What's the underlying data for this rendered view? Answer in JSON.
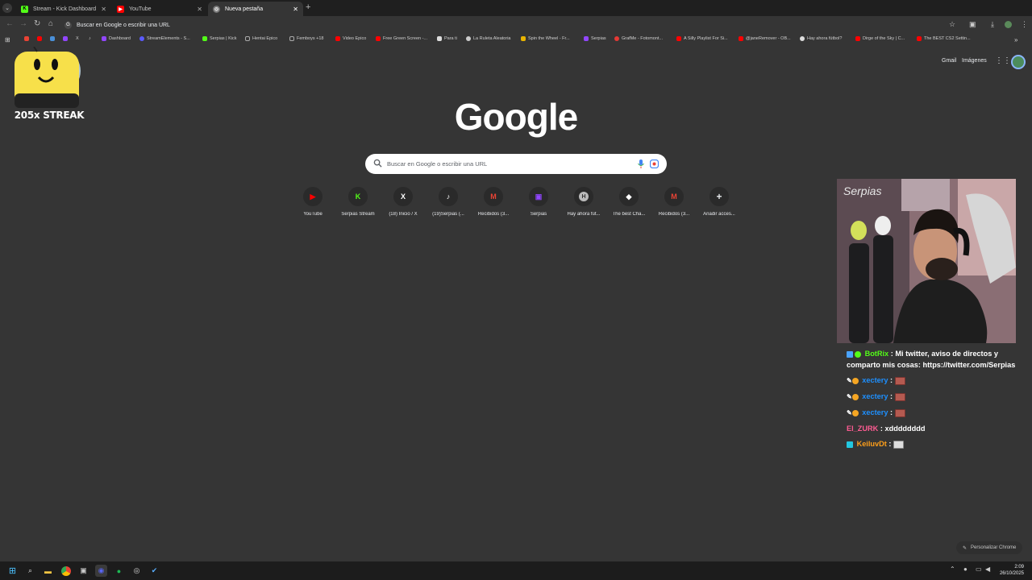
{
  "tabs": [
    {
      "title": "Stream - Kick Dashboard",
      "favicon": "K",
      "color": "#53fc18"
    },
    {
      "title": "YouTube",
      "favicon": "▶",
      "color": "#ff0000"
    },
    {
      "title": "Nueva pestaña",
      "favicon": "◎",
      "color": "#888888"
    }
  ],
  "omnibox": {
    "placeholder": "Buscar en Google o escribir una URL"
  },
  "bookmarks": [
    {
      "label": "Dashboard",
      "color": "#9146ff"
    },
    {
      "label": "StreamElements - S...",
      "color": "#5b5bff"
    },
    {
      "label": "Serpias | Kick",
      "color": "#53fc18"
    },
    {
      "label": "Hentai Epico",
      "color": "#aaaaaa"
    },
    {
      "label": "Femboys +18",
      "color": "#aaaaaa"
    },
    {
      "label": "Video Epico",
      "color": "#ff0000"
    },
    {
      "label": "Free Green Screen -...",
      "color": "#ff0000"
    },
    {
      "label": "Para ti",
      "color": "#dddddd"
    },
    {
      "label": "La Ruleta Aleatoria",
      "color": "#cccccc"
    },
    {
      "label": "Spin the Wheel - Fr...",
      "color": "#e8b400"
    },
    {
      "label": "Serpias",
      "color": "#9146ff"
    },
    {
      "label": "GrafMe - Fotomont...",
      "color": "#e53935"
    },
    {
      "label": "A Silly Playlist For Si...",
      "color": "#ff0000"
    },
    {
      "label": "@janeRemover - OB...",
      "color": "#ff0000"
    },
    {
      "label": "Hay ahora fútbol?",
      "color": "#dddddd"
    },
    {
      "label": "Dirge of the Sky | C...",
      "color": "#ff0000"
    },
    {
      "label": "The BEST CS2 Settin...",
      "color": "#ff0000"
    }
  ],
  "streak": {
    "label": "205x STREAK"
  },
  "header_links": {
    "gmail": "Gmail",
    "images": "Imágenes"
  },
  "logo": "Google",
  "search": {
    "placeholder": "Buscar en Google o escribir una URL"
  },
  "shortcuts": [
    {
      "label": "YouTube",
      "glyph": "▶",
      "color": "#ff0000"
    },
    {
      "label": "Serpias Stream",
      "glyph": "K",
      "color": "#53fc18"
    },
    {
      "label": "(18) Inicio / X",
      "glyph": "X",
      "color": "#ffffff"
    },
    {
      "label": "(19)Serpias (...",
      "glyph": "♪",
      "color": "#ffffff"
    },
    {
      "label": "Recibidos (3...",
      "glyph": "M",
      "color": "#ea4335"
    },
    {
      "label": "Serpias",
      "glyph": "▣",
      "color": "#9146ff"
    },
    {
      "label": "Hay ahora fút...",
      "glyph": "H",
      "color": "#cccccc"
    },
    {
      "label": "The best Cha...",
      "glyph": "◆",
      "color": "#ffffff"
    },
    {
      "label": "Recibidos (3...",
      "glyph": "M",
      "color": "#ea4335"
    },
    {
      "label": "Añadir acces...",
      "glyph": "+",
      "color": "#e8eaed"
    }
  ],
  "chat": [
    {
      "user": "BotRix",
      "user_color": "#53fc18",
      "text": "Mi twitter, aviso de directos y comparto mis cosas: https://twitter.com/Serpias",
      "sep": " : "
    },
    {
      "user": "xectery",
      "user_color": "#1e90ff",
      "text": "",
      "sep": " : ",
      "emote": true
    },
    {
      "user": "xectery",
      "user_color": "#1e90ff",
      "text": "",
      "sep": " : ",
      "emote": true
    },
    {
      "user": "xectery",
      "user_color": "#1e90ff",
      "text": "",
      "sep": " : ",
      "emote": true
    },
    {
      "user": "El_ZURK",
      "user_color": "#ff5c93",
      "text": "xdddddddd",
      "sep": " : "
    },
    {
      "user": "KeiluvDt",
      "user_color": "#ff9f1a",
      "text": "",
      "sep": " : ",
      "emote": true
    }
  ],
  "customize": "Personalizar Chrome",
  "clock": {
    "time": "2:09",
    "date": "26/10/2025"
  }
}
